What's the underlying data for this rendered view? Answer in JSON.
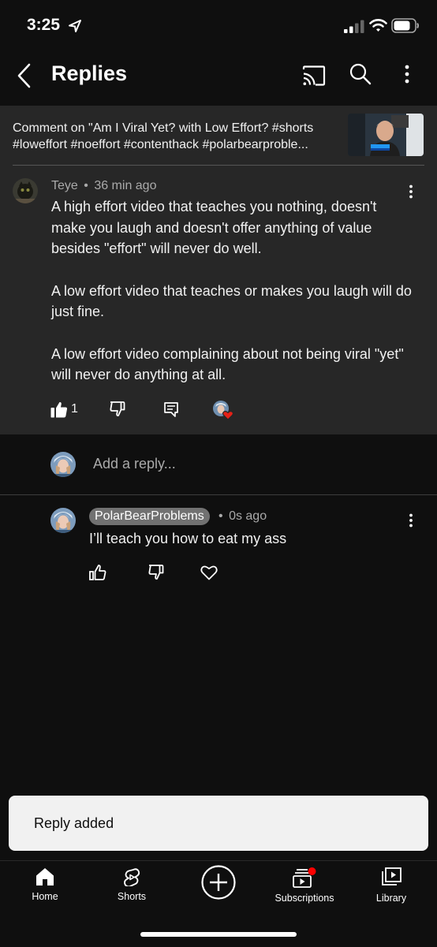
{
  "status_bar": {
    "time": "3:25"
  },
  "header": {
    "title": "Replies",
    "icons": [
      "back-icon",
      "cast-icon",
      "search-icon",
      "more-vert-icon"
    ]
  },
  "context": {
    "line1": "Comment on \"Am I Viral Yet? with Low Effort? #shorts",
    "line2": "#loweffort #noeffort #contenthack #polarbearproble..."
  },
  "comment": {
    "author": "Teye",
    "separator": "•",
    "time": "36 min ago",
    "paragraphs": [
      "A high effort video that teaches you nothing, doesn't make you laugh and doesn't offer anything of value besides \"effort\" will never do well.",
      "A low effort video that teaches or makes you laugh will do just fine.",
      "A low effort video complaining about not being viral \"yet\" will never do anything at all."
    ],
    "like_count": "1"
  },
  "add_reply": {
    "placeholder": "Add a reply..."
  },
  "reply": {
    "author": "PolarBearProblems",
    "separator": "•",
    "time": "0s ago",
    "text": "I’ll teach you how to eat my ass"
  },
  "toast": {
    "text": "Reply added"
  },
  "bottom_nav": [
    {
      "label": "Home",
      "icon": "home-icon"
    },
    {
      "label": "Shorts",
      "icon": "shorts-icon"
    },
    {
      "label": "",
      "icon": "create-icon"
    },
    {
      "label": "Subscriptions",
      "icon": "subscriptions-icon"
    },
    {
      "label": "Library",
      "icon": "library-icon"
    }
  ],
  "colors": {
    "background": "#0f0f0f",
    "card": "#272727",
    "notification_dot": "#ff0000",
    "heart_badge": "#e62117"
  }
}
